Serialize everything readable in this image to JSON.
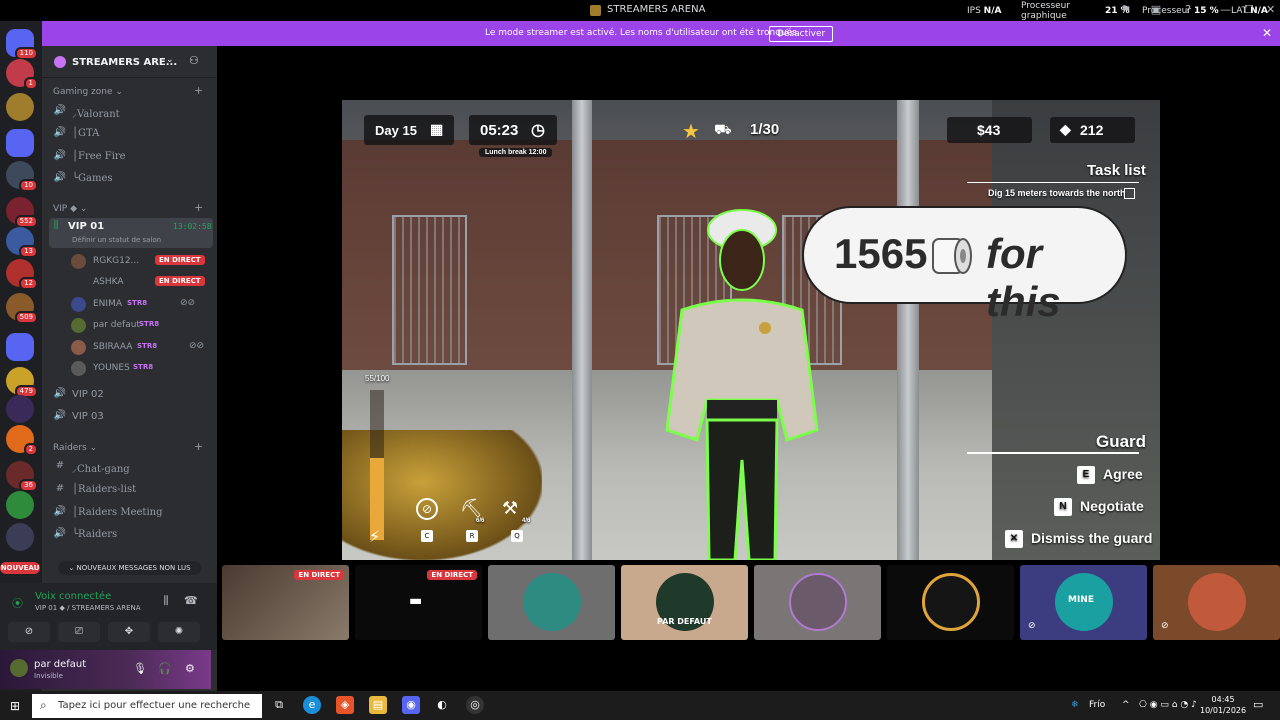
{
  "window": {
    "title": "STREAMERS ARENA"
  },
  "stats": {
    "ips_label": "IPS",
    "ips_value": "N/A",
    "gpu_label_1": "Processeur",
    "gpu_label_2": "graphique",
    "gpu_value": "21 %",
    "cpu_label": "Processeur",
    "cpu_value": "15 %",
    "lat_label": "LAT",
    "lat_value": "N/A"
  },
  "banner": {
    "message": "Le mode streamer est activé. Les noms d'utilisateur ont été tronqués.",
    "button": "Désactiver"
  },
  "rail": {
    "badges": [
      "110",
      "1",
      "10",
      "552",
      "13",
      "12",
      "509",
      "479",
      "2",
      "36"
    ],
    "nouveau": "NOUVEAU"
  },
  "guild": {
    "name": "STREAMERS ARE..."
  },
  "categories": {
    "gaming": "Gaming zone",
    "vip": "VIP",
    "raiders": "Raiders"
  },
  "channels": {
    "valorant": "⸝Valorant",
    "gta": "│GTA",
    "freefire": "│Free Fire",
    "games": "╰Games",
    "vip01": "VIP 01",
    "vip01_time": "13:02:58",
    "vip01_status": "Définir un statut de salon",
    "vip02": "VIP 02",
    "vip03": "VIP 03",
    "chatgang": "⸝Chat-gang",
    "raiderslist": "│Raiders-list",
    "raidersmeeting": "│Raiders Meeting",
    "raiders": "╰Raiders"
  },
  "voice_users": [
    {
      "name": "RGKG12...",
      "tag": "EN DIRECT"
    },
    {
      "name": "ASHKA",
      "tag": "EN DIRECT"
    },
    {
      "name": "ENIMA",
      "tag": "STR8"
    },
    {
      "name": "par defaut",
      "tag": "STR8"
    },
    {
      "name": "SBIRAAA",
      "tag": "STR8"
    },
    {
      "name": "YOUNES",
      "tag": "STR8"
    }
  ],
  "unread": "NOUVEAUX MESSAGES NON LUS",
  "voice_panel": {
    "status": "Voix connectée",
    "channel": "VIP 01",
    "server": "/ STREAMERS ARENA"
  },
  "user_panel": {
    "name": "par defaut",
    "status": "Invisible"
  },
  "game": {
    "day": "Day 15",
    "time": "05:23",
    "lunch": "Lunch break 12:00",
    "count": "1/30",
    "money": "$43",
    "gems": "212",
    "task_title": "Task list",
    "task_item": "Dig 15 meters towards the north",
    "bubble_number": "1565",
    "bubble_text": "for this",
    "stamina": "55/100",
    "slot_counts": [
      "6/6",
      "4/6"
    ],
    "slot_keys": [
      "C",
      "R",
      "Q"
    ],
    "npc_name": "Guard",
    "actions": [
      {
        "key": "E",
        "label": "Agree"
      },
      {
        "key": "N",
        "label": "Negotiate"
      },
      {
        "key": "✕",
        "label": "Dismiss the guard"
      }
    ]
  },
  "tiles": {
    "live": "EN DIRECT",
    "defaut": "PAR DEFAUT",
    "mine": "MINE"
  },
  "taskbar": {
    "search_placeholder": "Tapez ici pour effectuer une recherche",
    "weather": "Frío",
    "time": "04:45",
    "date": "10/01/2026"
  }
}
